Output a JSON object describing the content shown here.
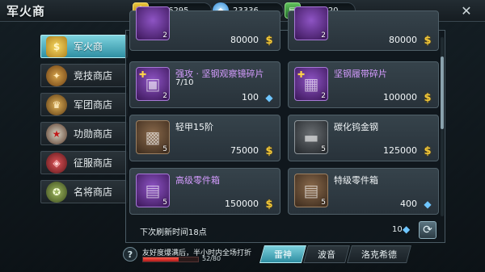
{
  "header": {
    "title": "军火商",
    "gold": "5096295",
    "gems": "23336",
    "pass": "311/120",
    "gold_icon": "$",
    "gem_icon": "◆",
    "pass_icon": "▤",
    "close_icon": "✕"
  },
  "menu": [
    {
      "label": "军火商",
      "icon": "dollar-icon",
      "glyph": "$",
      "active": true
    },
    {
      "label": "竞技商店",
      "icon": "emblem-icon",
      "glyph": "✦",
      "active": false
    },
    {
      "label": "军团商店",
      "icon": "trophy-icon",
      "glyph": "♛",
      "active": false
    },
    {
      "label": "功勋商店",
      "icon": "star-icon",
      "glyph": "★",
      "active": false
    },
    {
      "label": "征服商店",
      "icon": "shield-icon",
      "glyph": "◈",
      "active": false
    },
    {
      "label": "名将商店",
      "icon": "medal-icon",
      "glyph": "✪",
      "active": false
    }
  ],
  "items": [
    {
      "name": "",
      "progress": "",
      "count": "2",
      "price": "80000",
      "currency": "gold"
    },
    {
      "name": "",
      "progress": "",
      "count": "2",
      "price": "80000",
      "currency": "gold"
    },
    {
      "name": "强攻 · 坚钢观察镜碎片",
      "progress": "7/10",
      "count": "2",
      "price": "100",
      "currency": "gem"
    },
    {
      "name": "坚钢履带碎片",
      "progress": "",
      "count": "2",
      "price": "100000",
      "currency": "gold"
    },
    {
      "name": "轻甲15阶",
      "progress": "",
      "count": "5",
      "price": "75000",
      "currency": "gold"
    },
    {
      "name": "碳化钨金钢",
      "progress": "",
      "count": "5",
      "price": "125000",
      "currency": "gold"
    },
    {
      "name": "高级零件箱",
      "progress": "",
      "count": "5",
      "price": "150000",
      "currency": "gold"
    },
    {
      "name": "特级零件箱",
      "progress": "",
      "count": "5",
      "price": "400",
      "currency": "gem"
    }
  ],
  "refresh": {
    "label": "下次刷新时间18点",
    "cost": "10"
  },
  "tip": {
    "text": "友好度爆满后，半小时内全场打折",
    "count": "52/80",
    "fill": 0.65
  },
  "tabs": [
    "雷神",
    "波音",
    "洛克希德"
  ],
  "active_tab": 0,
  "colors": {
    "accent": "#2f8fa3",
    "purple_name": "#d59cff",
    "gold": "#f3c93a",
    "gem": "#6fc6ff"
  }
}
